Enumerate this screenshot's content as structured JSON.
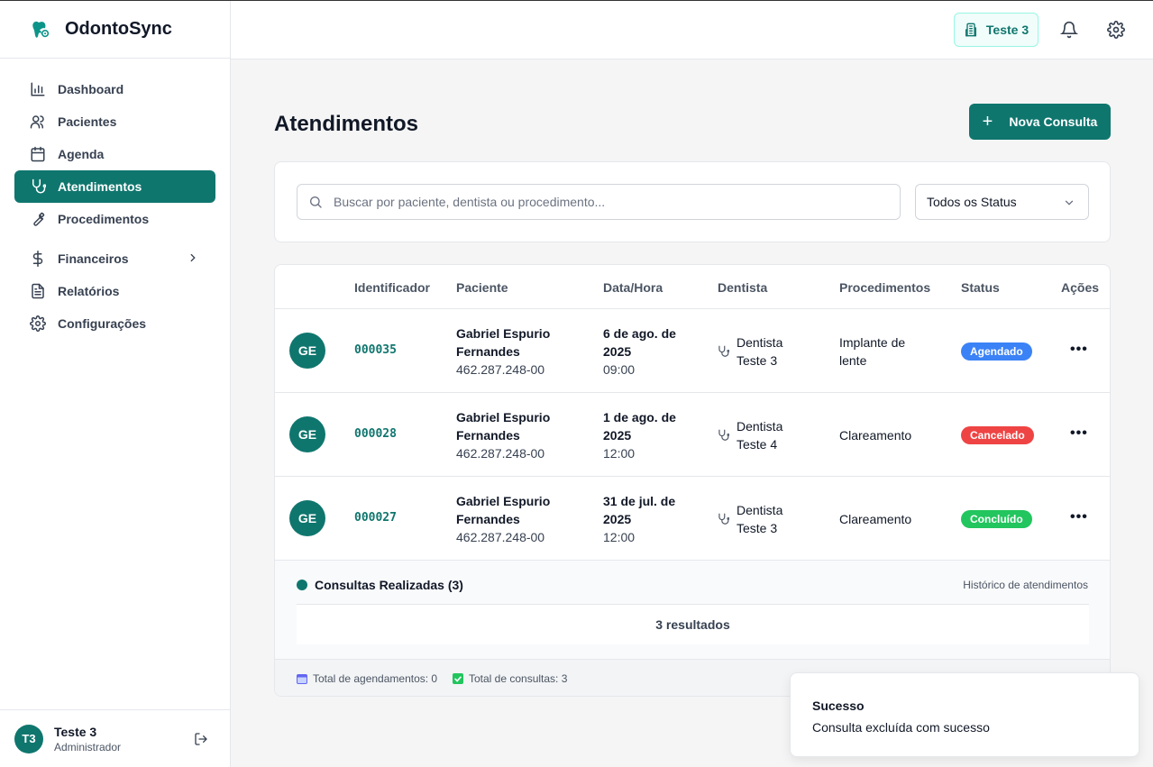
{
  "app": {
    "name": "OdontoSync"
  },
  "sidebar": {
    "items": [
      {
        "label": "Dashboard",
        "icon": "bar-chart-icon"
      },
      {
        "label": "Pacientes",
        "icon": "users-icon"
      },
      {
        "label": "Agenda",
        "icon": "calendar-icon"
      },
      {
        "label": "Atendimentos",
        "icon": "stethoscope-icon",
        "active": true
      },
      {
        "label": "Procedimentos",
        "icon": "wrench-icon"
      },
      {
        "label": "Financeiros",
        "icon": "dollar-icon",
        "expandable": true
      },
      {
        "label": "Relatórios",
        "icon": "file-text-icon"
      },
      {
        "label": "Configurações",
        "icon": "settings-icon"
      }
    ],
    "user": {
      "initials": "T3",
      "name": "Teste 3",
      "role": "Administrador"
    }
  },
  "topbar": {
    "clinic": "Teste 3"
  },
  "main": {
    "title": "Atendimentos",
    "new_button": "Nova Consulta",
    "search_placeholder": "Buscar por paciente, dentista ou procedimento...",
    "status_filter": "Todos os Status",
    "columns": [
      "Identificador",
      "Paciente",
      "Data/Hora",
      "Dentista",
      "Procedimentos",
      "Status",
      "Ações"
    ],
    "rows": [
      {
        "initials": "GE",
        "id": "000035",
        "patient_line1": "Gabriel Espurio",
        "patient_line2": "Fernandes",
        "cpf": "462.287.248-00",
        "date_line1": "6 de ago. de",
        "date_line2": "2025",
        "time": "09:00",
        "dentist_line1": "Dentista",
        "dentist_line2": "Teste 3",
        "proc_line1": "Implante de",
        "proc_line2": "lente",
        "status": "Agendado",
        "status_color": "#3b82f6"
      },
      {
        "initials": "GE",
        "id": "000028",
        "patient_line1": "Gabriel Espurio",
        "patient_line2": "Fernandes",
        "cpf": "462.287.248-00",
        "date_line1": "1 de ago. de",
        "date_line2": "2025",
        "time": "12:00",
        "dentist_line1": "Dentista",
        "dentist_line2": "Teste 4",
        "proc_line1": "Clareamento",
        "proc_line2": "",
        "status": "Cancelado",
        "status_color": "#ef4444"
      },
      {
        "initials": "GE",
        "id": "000027",
        "patient_line1": "Gabriel Espurio",
        "patient_line2": "Fernandes",
        "cpf": "462.287.248-00",
        "date_line1": "31 de jul. de",
        "date_line2": "2025",
        "time": "12:00",
        "dentist_line1": "Dentista",
        "dentist_line2": "Teste 3",
        "proc_line1": "Clareamento",
        "proc_line2": "",
        "status": "Concluído",
        "status_color": "#22c55e"
      }
    ],
    "summary": {
      "title": "Consultas Realizadas (3)",
      "hint": "Histórico de atendimentos",
      "results": "3 resultados"
    },
    "stats": {
      "appointments": "Total de agendamentos: 0",
      "consultations": "Total de consultas: 3"
    }
  },
  "toast": {
    "title": "Sucesso",
    "message": "Consulta excluída com sucesso"
  },
  "colors": {
    "primary": "#0f766e",
    "agendado": "#3b82f6",
    "cancelado": "#ef4444",
    "concluido": "#22c55e"
  }
}
